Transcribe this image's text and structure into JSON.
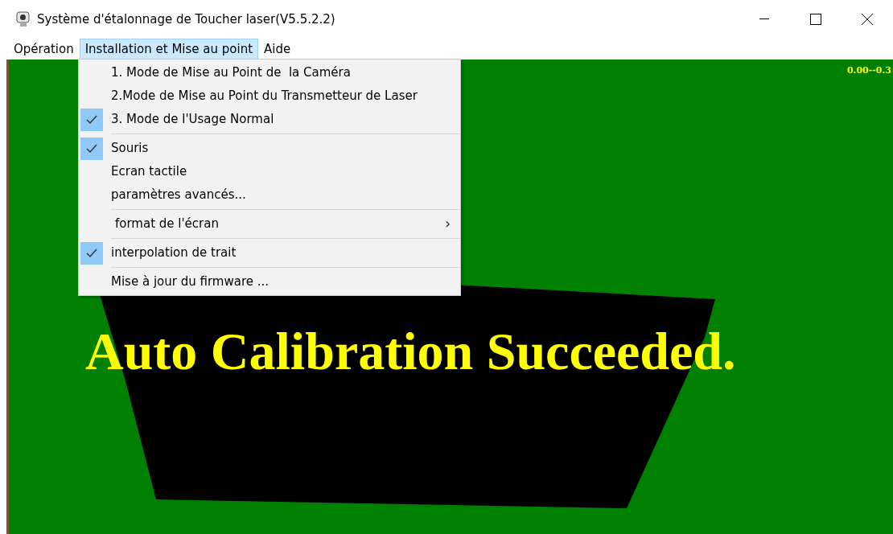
{
  "window": {
    "title": "Système d'étalonnage de Toucher laser(V5.5.2.2)"
  },
  "menu_bar": [
    {
      "label": "Opération",
      "selected": false
    },
    {
      "label": "Installation et Mise au point",
      "selected": true
    },
    {
      "label": "Aide",
      "selected": false
    }
  ],
  "dropdown": {
    "items": [
      {
        "kind": "item",
        "label": "1. Mode de Mise au Point de  la Caméra",
        "checked": false
      },
      {
        "kind": "item",
        "label": "2.Mode de Mise au Point du Transmetteur de Laser",
        "checked": false
      },
      {
        "kind": "item",
        "label": "3. Mode de l'Usage Normal",
        "checked": true
      },
      {
        "kind": "separator"
      },
      {
        "kind": "item",
        "label": "Souris",
        "checked": true
      },
      {
        "kind": "item",
        "label": "Ecran tactile",
        "checked": false
      },
      {
        "kind": "item",
        "label": "paramètres avancés...",
        "checked": false
      },
      {
        "kind": "separator"
      },
      {
        "kind": "submenu",
        "label": "format de l'écran",
        "arrow": "›",
        "checked": false
      },
      {
        "kind": "separator"
      },
      {
        "kind": "item",
        "label": "interpolation de trait",
        "checked": true
      },
      {
        "kind": "separator"
      },
      {
        "kind": "item",
        "label": "Mise à jour du firmware ...",
        "checked": false
      }
    ]
  },
  "canvas": {
    "range": "0.00--0.3",
    "message": "Auto Calibration Succeeded."
  }
}
